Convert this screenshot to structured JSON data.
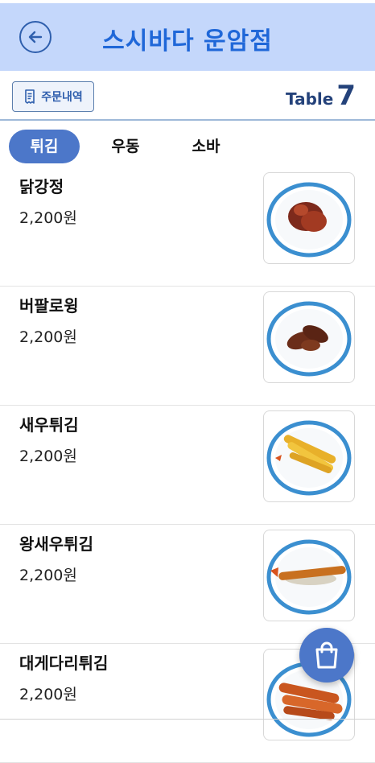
{
  "header": {
    "title": "스시바다 운암점",
    "back_icon": "arrow-left-circle-icon",
    "accent": "#1f67d8",
    "background": "#c4d7fb"
  },
  "subbar": {
    "order_history_label": "주문내역",
    "order_icon": "receipt-icon",
    "table_word": "Table",
    "table_number": "7"
  },
  "tabs": [
    {
      "label": "튀김",
      "active": true
    },
    {
      "label": "우동",
      "active": false
    },
    {
      "label": "소바",
      "active": false
    }
  ],
  "items": [
    {
      "name": "닭강정",
      "price": "2,200원",
      "image": "sweet-crispy-chicken-plate"
    },
    {
      "name": "버팔로윙",
      "price": "2,200원",
      "image": "buffalo-wing-plate"
    },
    {
      "name": "새우튀김",
      "price": "2,200원",
      "image": "shrimp-tempura-plate"
    },
    {
      "name": "왕새우튀김",
      "price": "2,200원",
      "image": "king-shrimp-tempura-plate"
    },
    {
      "name": "대게다리튀김",
      "price": "2,200원",
      "image": "snow-crab-leg-tempura-plate"
    }
  ],
  "cart": {
    "icon": "shopping-bag-icon",
    "color": "#4c77c9"
  }
}
